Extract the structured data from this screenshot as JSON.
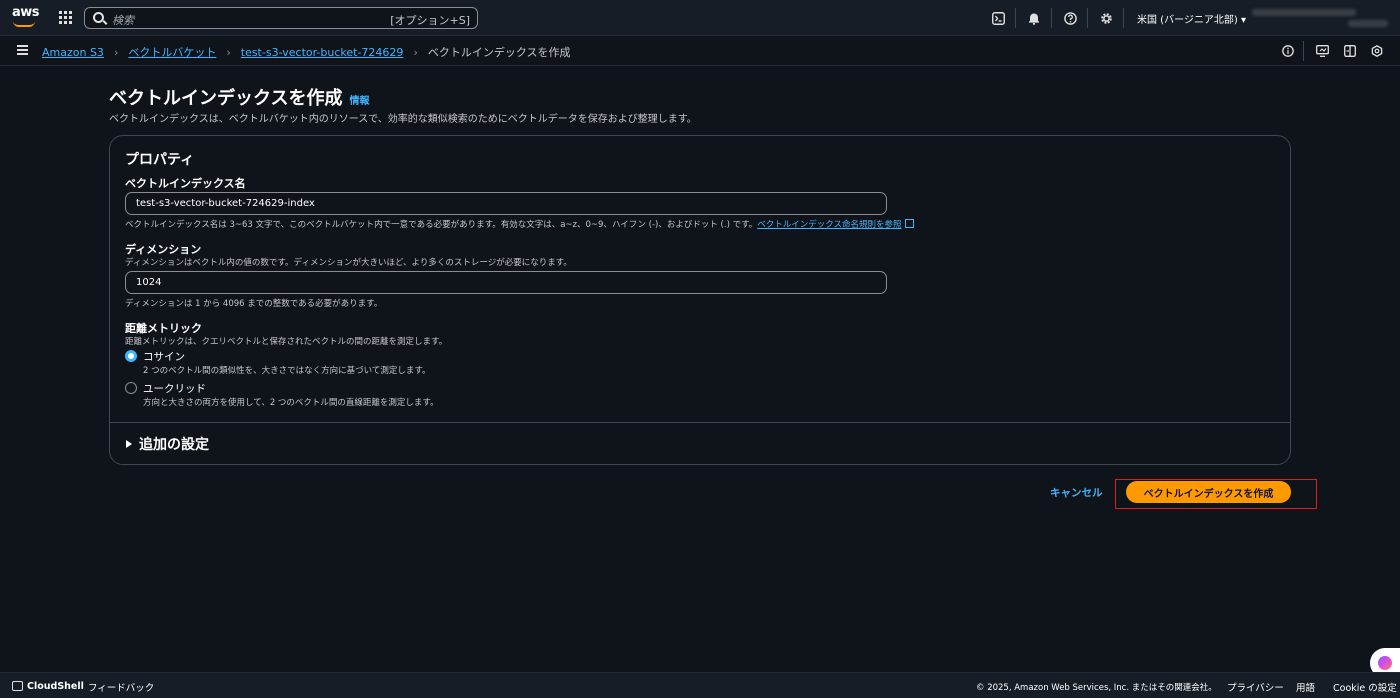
{
  "topbar": {
    "search_placeholder": "検索",
    "search_shortcut": "[オプション+S]",
    "region": "米国 (バージニア北部) ▾",
    "icons": [
      "cloudshell-icon",
      "bell-icon",
      "help-icon",
      "gear-icon"
    ]
  },
  "breadcrumb": {
    "items": [
      "Amazon S3",
      "ベクトルバケット",
      "test-s3-vector-bucket-724629"
    ],
    "current": "ベクトルインデックスを作成"
  },
  "page": {
    "title": "ベクトルインデックスを作成",
    "info_link": "情報",
    "description": "ベクトルインデックスは、ベクトルバケット内のリソースで、効率的な類似検索のためにベクトルデータを保存および整理します。"
  },
  "properties": {
    "heading": "プロパティ",
    "index_name": {
      "label": "ベクトルインデックス名",
      "value": "test-s3-vector-bucket-724629-index",
      "hint": "ベクトルインデックス名は 3~63 文字で、このベクトルバケット内で一意である必要があります。有効な文字は、a~z、0~9、ハイフン (-)、およびドット (.) です。",
      "hint_link": "ベクトルインデックス命名規則を参照"
    },
    "dimension": {
      "label": "ディメンション",
      "description": "ディメンションはベクトル内の値の数です。ディメンションが大きいほど、より多くのストレージが必要になります。",
      "value": "1024",
      "hint": "ディメンションは 1 から 4096 までの整数である必要があります。"
    },
    "metric": {
      "label": "距離メトリック",
      "description": "距離メトリックは、クエリベクトルと保存されたベクトルの間の距離を測定します。",
      "options": [
        {
          "label": "コサイン",
          "description": "2 つのベクトル間の類似性を、大きさではなく方向に基づいて測定します。",
          "selected": true
        },
        {
          "label": "ユークリッド",
          "description": "方向と大きさの両方を使用して、2 つのベクトル間の直線距離を測定します。",
          "selected": false
        }
      ]
    },
    "additional_settings": "追加の設定"
  },
  "actions": {
    "cancel": "キャンセル",
    "create": "ベクトルインデックスを作成"
  },
  "footer": {
    "cloudshell": "CloudShell",
    "feedback": "フィードバック",
    "copyright": "© 2025, Amazon Web Services, Inc. またはその関連会社。",
    "privacy": "プライバシー",
    "terms": "用語",
    "cookie": "Cookie の設定"
  },
  "colors": {
    "accent": "#42b4ff",
    "primary_button": "#ff9900",
    "background": "#0f141a",
    "highlight": "#e01d1d"
  }
}
